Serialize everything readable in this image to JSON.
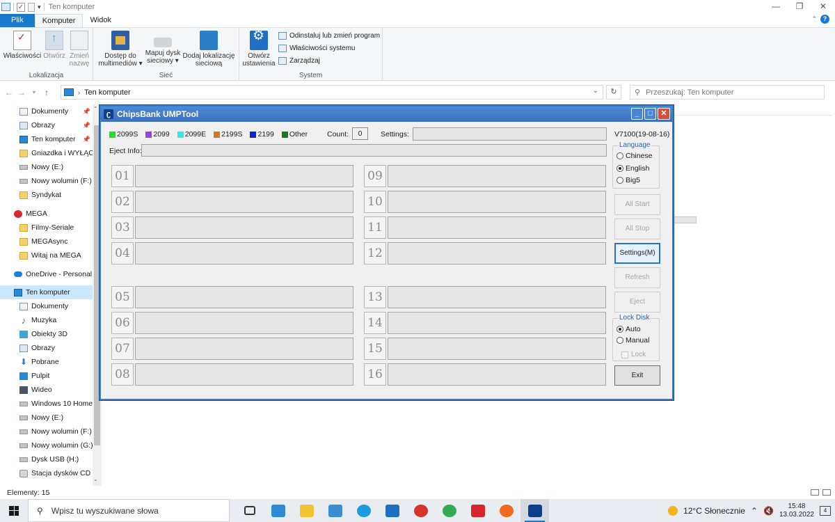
{
  "explorer": {
    "window_title": "Ten komputer",
    "ribbon_tabs": [
      "Plik",
      "Komputer",
      "Widok"
    ],
    "ribbon": {
      "location_group": {
        "label": "Lokalizacja",
        "properties": "Właściwości",
        "open": "Otwórz",
        "rename_l1": "Zmień",
        "rename_l2": "nazwę"
      },
      "network_group": {
        "label": "Sieć",
        "media_l1": "Dostęp do",
        "media_l2": "multimediów ▾",
        "map_l1": "Mapuj dysk",
        "map_l2": "sieciowy ▾",
        "addnet_l1": "Dodaj lokalizację",
        "addnet_l2": "sieciową"
      },
      "system_group": {
        "label": "System",
        "open_settings_l1": "Otwórz",
        "open_settings_l2": "ustawienia",
        "uninstall": "Odinstaluj lub zmień program",
        "system_props": "Właściwości systemu",
        "manage": "Zarządzaj"
      }
    },
    "address": "Ten komputer",
    "search_placeholder": "Przeszukaj: Ten komputer",
    "nav_items": [
      {
        "label": "Dokumenty",
        "icon": "document-icon"
      },
      {
        "label": "Obrazy",
        "icon": "pictures-icon"
      },
      {
        "label": "Ten komputer",
        "icon": "computer-icon"
      },
      {
        "label": "Gniazdka i WYŁĄCZI",
        "icon": "folder-icon"
      },
      {
        "label": "Nowy (E:)",
        "icon": "drive-icon"
      },
      {
        "label": "Nowy wolumin (F:)",
        "icon": "drive-icon"
      },
      {
        "label": "Syndykat",
        "icon": "folder-icon"
      },
      {
        "label": "MEGA",
        "icon": "mega-icon"
      },
      {
        "label": "Filmy-Seriale",
        "icon": "folder-icon"
      },
      {
        "label": "MEGAsync",
        "icon": "folder-icon"
      },
      {
        "label": "Witaj na MEGA",
        "icon": "folder-icon"
      },
      {
        "label": "OneDrive - Personal",
        "icon": "onedrive-icon"
      },
      {
        "label": "Ten komputer",
        "icon": "computer-icon"
      },
      {
        "label": "Dokumenty",
        "icon": "document-icon"
      },
      {
        "label": "Muzyka",
        "icon": "music-icon"
      },
      {
        "label": "Obiekty 3D",
        "icon": "objects-3d-icon"
      },
      {
        "label": "Obrazy",
        "icon": "pictures-icon"
      },
      {
        "label": "Pobrane",
        "icon": "download-icon"
      },
      {
        "label": "Pulpit",
        "icon": "desktop-icon"
      },
      {
        "label": "Wideo",
        "icon": "video-icon"
      },
      {
        "label": "Windows 10 Home (",
        "icon": "drive-icon"
      },
      {
        "label": "Nowy (E:)",
        "icon": "drive-icon"
      },
      {
        "label": "Nowy wolumin (F:)",
        "icon": "drive-icon"
      },
      {
        "label": "Nowy wolumin (G:)",
        "icon": "drive-icon"
      },
      {
        "label": "Dysk USB (H:)",
        "icon": "drive-icon"
      },
      {
        "label": "Stacja dysków CD (J:",
        "icon": "cd-drive-icon"
      }
    ],
    "status": "Elementy: 15"
  },
  "dialog": {
    "title": "ChipsBank UMPTool",
    "legend": [
      {
        "label": "2099S",
        "color": "#22dd22"
      },
      {
        "label": "2099",
        "color": "#a040e0"
      },
      {
        "label": "2099E",
        "color": "#30e8e8"
      },
      {
        "label": "2199S",
        "color": "#d07a20"
      },
      {
        "label": "2199",
        "color": "#1020d8"
      },
      {
        "label": "Other",
        "color": "#1a7a1a"
      }
    ],
    "count_label": "Count:",
    "count_value": "0",
    "settings_label": "Settings:",
    "version": "V7100(19-08-16)",
    "eject_label": "Eject Info:",
    "ports": [
      "01",
      "02",
      "03",
      "04",
      "05",
      "06",
      "07",
      "08",
      "09",
      "10",
      "11",
      "12",
      "13",
      "14",
      "15",
      "16"
    ],
    "language": {
      "title": "Language",
      "options": [
        "Chinese",
        "English",
        "Big5"
      ],
      "selected": "English"
    },
    "buttons": {
      "all_start": "All Start",
      "all_stop": "All Stop",
      "settings": "Settings(M)",
      "refresh": "Refresh",
      "eject": "Eject",
      "exit": "Exit"
    },
    "lock_disk": {
      "title": "Lock Disk",
      "options": [
        "Auto",
        "Manual"
      ],
      "selected": "Auto",
      "lock_label": "Lock"
    }
  },
  "taskbar": {
    "search_placeholder": "Wpisz tu wyszukiwane słowa",
    "apps": [
      {
        "name": "task-view-icon",
        "color": "#333333"
      },
      {
        "name": "desktop-app-icon",
        "color": "#2b8ad6"
      },
      {
        "name": "file-explorer-icon",
        "color": "#f2c230"
      },
      {
        "name": "photos-icon",
        "color": "#3a8fd4"
      },
      {
        "name": "skype-icon",
        "color": "#1b9be0"
      },
      {
        "name": "mail-icon",
        "color": "#1f6fc2"
      },
      {
        "name": "recovery-icon",
        "color": "#d8332a"
      },
      {
        "name": "chrome-icon",
        "color": "#34a853"
      },
      {
        "name": "anydesk-icon",
        "color": "#d6242b"
      },
      {
        "name": "firefox-icon",
        "color": "#f06a1f"
      },
      {
        "name": "chipsbank-icon",
        "color": "#0d3f8c"
      }
    ],
    "weather": "12°C  Słonecznie",
    "time": "15:48",
    "date": "13.03.2022"
  }
}
